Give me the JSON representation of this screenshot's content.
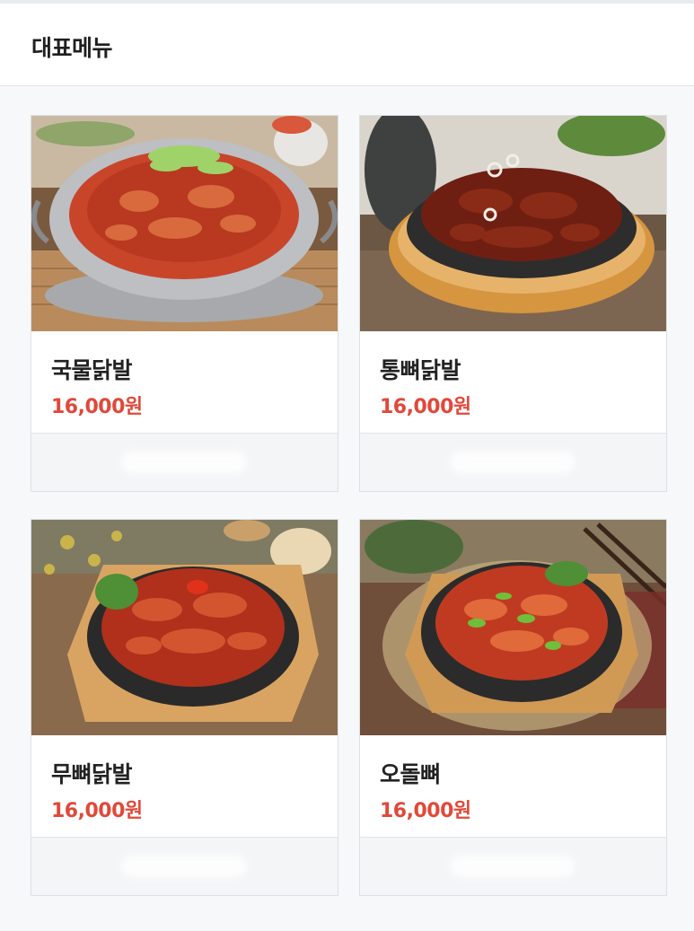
{
  "header": {
    "title": "대표메뉴"
  },
  "menu": {
    "items": [
      {
        "name": "국물닭발",
        "price": "16,000원",
        "photo": "pot"
      },
      {
        "name": "통뼈닭발",
        "price": "16,000원",
        "photo": "oval-plate"
      },
      {
        "name": "무뼈닭발",
        "price": "16,000원",
        "photo": "round-plate"
      },
      {
        "name": "오돌뼈",
        "price": "16,000원",
        "photo": "round-plate-peppers"
      }
    ]
  },
  "colors": {
    "price": "#e0493a",
    "title": "#1f1f1f",
    "background": "#f7f8fa",
    "card_border": "#dde0e4"
  }
}
